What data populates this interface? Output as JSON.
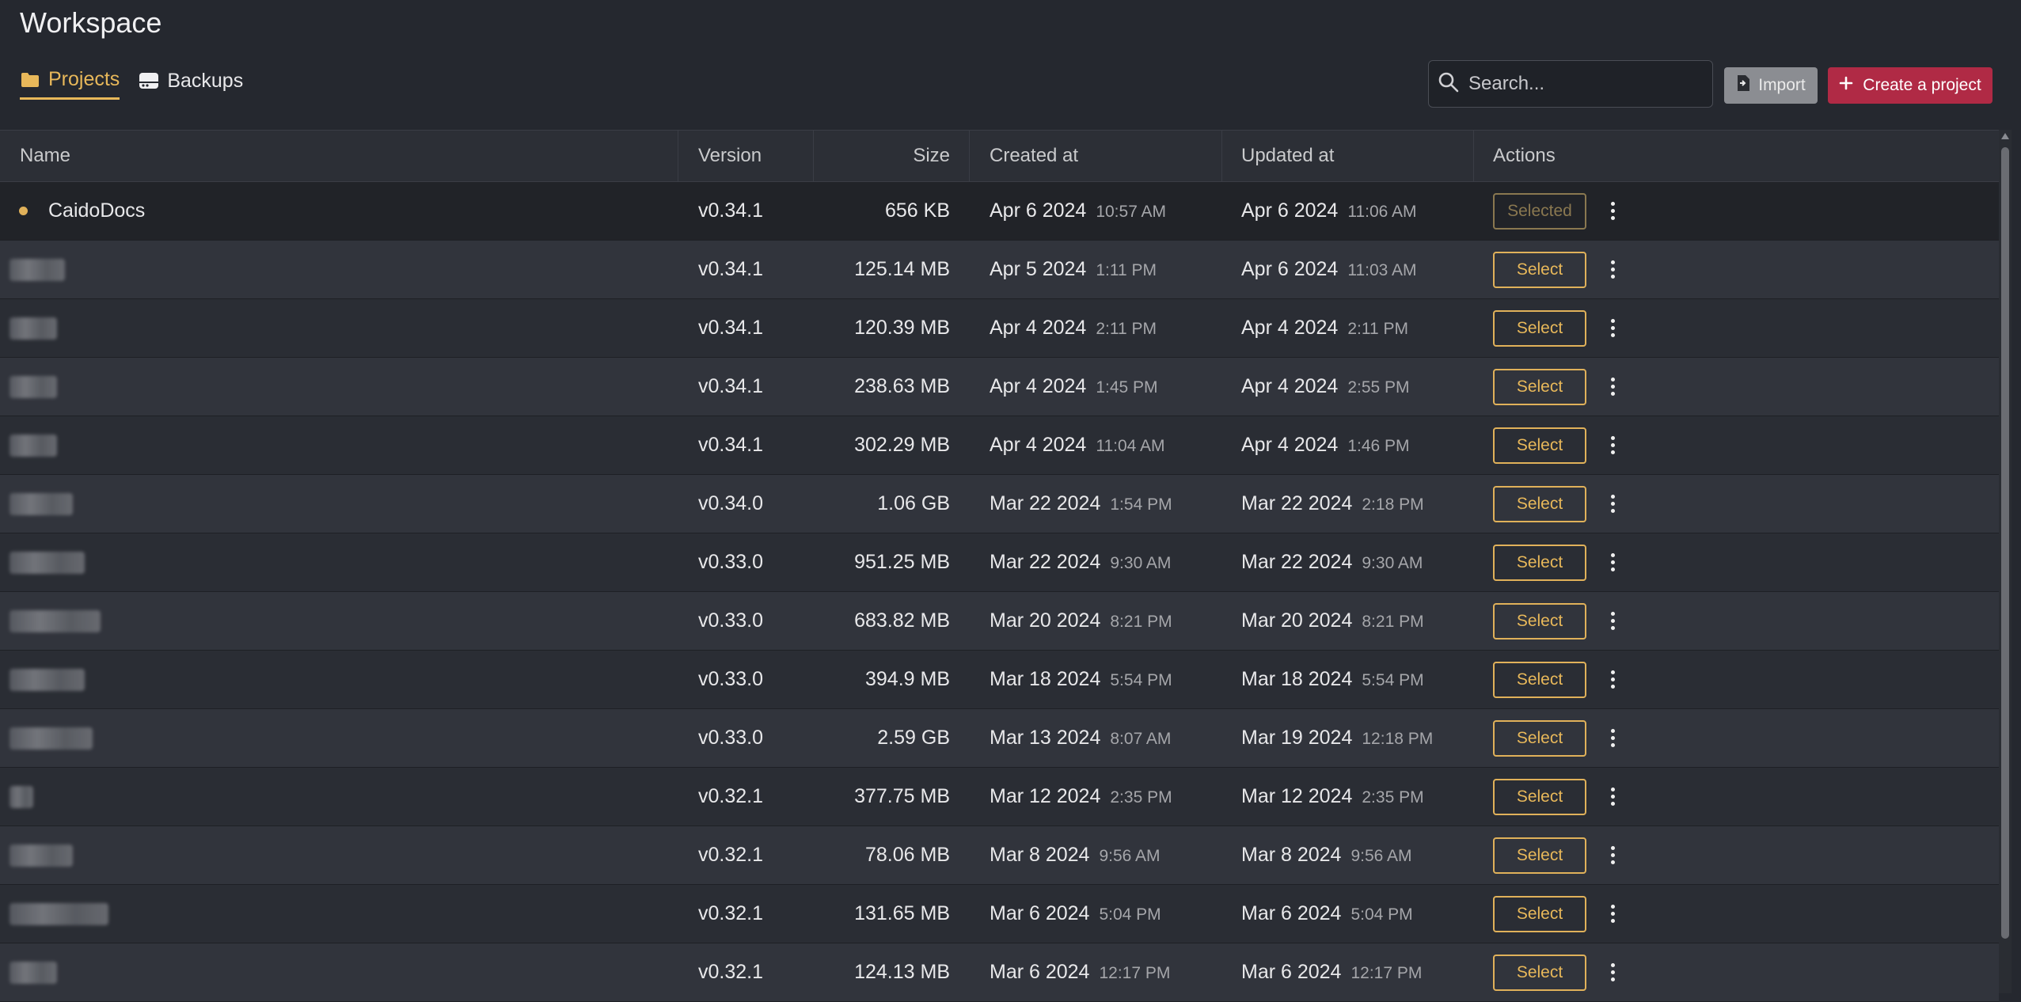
{
  "page": {
    "title": "Workspace"
  },
  "tabs": [
    {
      "label": "Projects",
      "icon": "folder-icon",
      "active": true
    },
    {
      "label": "Backups",
      "icon": "drive-icon",
      "active": false
    }
  ],
  "search": {
    "placeholder": "Search...",
    "value": ""
  },
  "buttons": {
    "import_label": "Import",
    "create_label": "Create a project"
  },
  "colors": {
    "accent": "#e8b85a",
    "create": "#b02a45",
    "background": "#25282f"
  },
  "table": {
    "headers": {
      "name": "Name",
      "version": "Version",
      "size": "Size",
      "created": "Created at",
      "updated": "Updated at",
      "actions": "Actions"
    },
    "selected_label": "Selected",
    "select_label": "Select",
    "rows": [
      {
        "name": "CaidoDocs",
        "blurred": false,
        "selected": true,
        "version": "v0.34.1",
        "size": "656 KB",
        "created_date": "Apr 6 2024",
        "created_time": "10:57 AM",
        "updated_date": "Apr 6 2024",
        "updated_time": "11:06 AM"
      },
      {
        "name": "",
        "blurred": true,
        "selected": false,
        "version": "v0.34.1",
        "size": "125.14 MB",
        "created_date": "Apr 5 2024",
        "created_time": "1:11 PM",
        "updated_date": "Apr 6 2024",
        "updated_time": "11:03 AM"
      },
      {
        "name": "",
        "blurred": true,
        "selected": false,
        "version": "v0.34.1",
        "size": "120.39 MB",
        "created_date": "Apr 4 2024",
        "created_time": "2:11 PM",
        "updated_date": "Apr 4 2024",
        "updated_time": "2:11 PM"
      },
      {
        "name": "",
        "blurred": true,
        "selected": false,
        "version": "v0.34.1",
        "size": "238.63 MB",
        "created_date": "Apr 4 2024",
        "created_time": "1:45 PM",
        "updated_date": "Apr 4 2024",
        "updated_time": "2:55 PM"
      },
      {
        "name": "",
        "blurred": true,
        "selected": false,
        "version": "v0.34.1",
        "size": "302.29 MB",
        "created_date": "Apr 4 2024",
        "created_time": "11:04 AM",
        "updated_date": "Apr 4 2024",
        "updated_time": "1:46 PM"
      },
      {
        "name": "",
        "blurred": true,
        "selected": false,
        "version": "v0.34.0",
        "size": "1.06 GB",
        "created_date": "Mar 22 2024",
        "created_time": "1:54 PM",
        "updated_date": "Mar 22 2024",
        "updated_time": "2:18 PM"
      },
      {
        "name": "",
        "blurred": true,
        "selected": false,
        "version": "v0.33.0",
        "size": "951.25 MB",
        "created_date": "Mar 22 2024",
        "created_time": "9:30 AM",
        "updated_date": "Mar 22 2024",
        "updated_time": "9:30 AM"
      },
      {
        "name": "",
        "blurred": true,
        "selected": false,
        "version": "v0.33.0",
        "size": "683.82 MB",
        "created_date": "Mar 20 2024",
        "created_time": "8:21 PM",
        "updated_date": "Mar 20 2024",
        "updated_time": "8:21 PM"
      },
      {
        "name": "",
        "blurred": true,
        "selected": false,
        "version": "v0.33.0",
        "size": "394.9 MB",
        "created_date": "Mar 18 2024",
        "created_time": "5:54 PM",
        "updated_date": "Mar 18 2024",
        "updated_time": "5:54 PM"
      },
      {
        "name": "",
        "blurred": true,
        "selected": false,
        "version": "v0.33.0",
        "size": "2.59 GB",
        "created_date": "Mar 13 2024",
        "created_time": "8:07 AM",
        "updated_date": "Mar 19 2024",
        "updated_time": "12:18 PM"
      },
      {
        "name": "",
        "blurred": true,
        "selected": false,
        "version": "v0.32.1",
        "size": "377.75 MB",
        "created_date": "Mar 12 2024",
        "created_time": "2:35 PM",
        "updated_date": "Mar 12 2024",
        "updated_time": "2:35 PM"
      },
      {
        "name": "",
        "blurred": true,
        "selected": false,
        "version": "v0.32.1",
        "size": "78.06 MB",
        "created_date": "Mar 8 2024",
        "created_time": "9:56 AM",
        "updated_date": "Mar 8 2024",
        "updated_time": "9:56 AM"
      },
      {
        "name": "",
        "blurred": true,
        "selected": false,
        "version": "v0.32.1",
        "size": "131.65 MB",
        "created_date": "Mar 6 2024",
        "created_time": "5:04 PM",
        "updated_date": "Mar 6 2024",
        "updated_time": "5:04 PM"
      },
      {
        "name": "",
        "blurred": true,
        "selected": false,
        "version": "v0.32.1",
        "size": "124.13 MB",
        "created_date": "Mar 6 2024",
        "created_time": "12:17 PM",
        "updated_date": "Mar 6 2024",
        "updated_time": "12:17 PM"
      }
    ]
  }
}
